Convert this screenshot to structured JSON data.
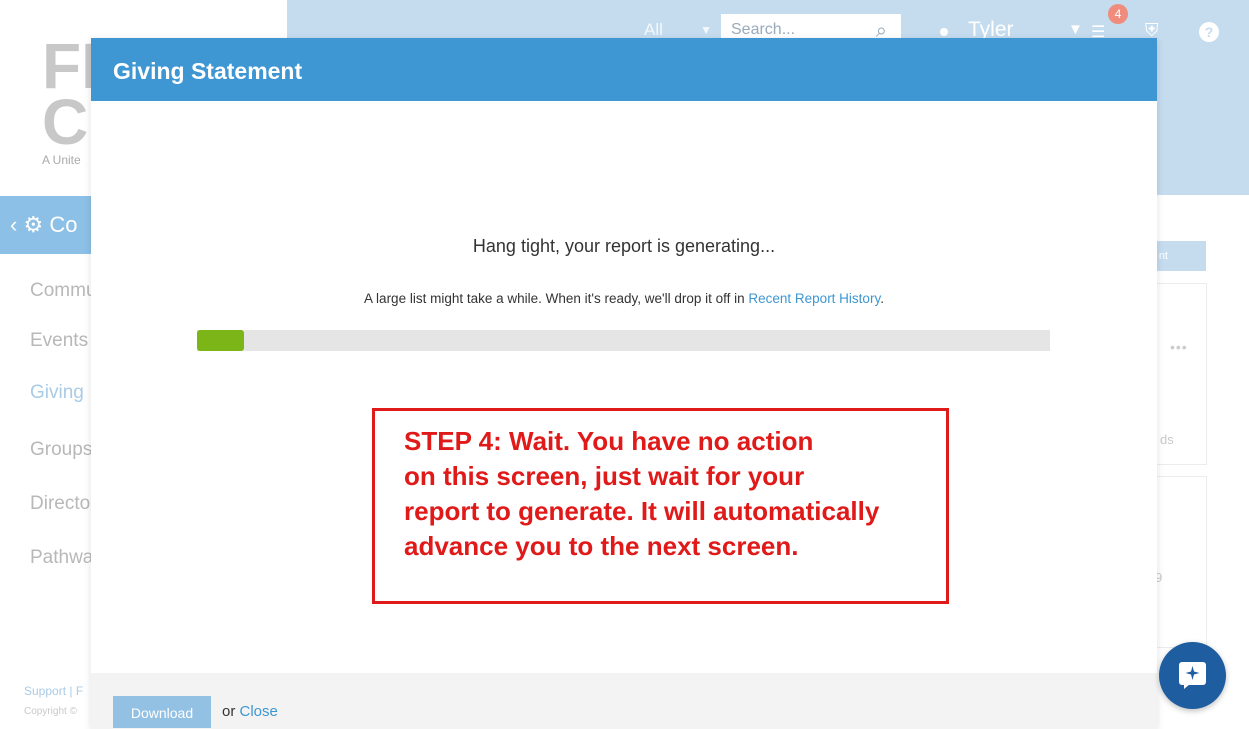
{
  "header": {
    "scope_select": "All",
    "search_placeholder": "Search...",
    "user_name": "Tyler",
    "notification_count": "4"
  },
  "sidebar": {
    "logo_text": "FI\nCI",
    "logo_sub": "A Unite",
    "section_label": "Co",
    "items": [
      {
        "label": "Commu"
      },
      {
        "label": "Events"
      },
      {
        "label": "Giving"
      },
      {
        "label": "Groups"
      },
      {
        "label": "Directo"
      },
      {
        "label": "Pathwa"
      }
    ],
    "footer_links": "Support | F",
    "copyright": "Copyright ©"
  },
  "background": {
    "button_label": "nt",
    "text_ds": "ds",
    "text_nine": "9"
  },
  "modal": {
    "title": "Giving Statement",
    "generating_title": "Hang tight, your report is generating...",
    "generating_sub": "A large list might take a while. When it's ready, we'll drop it off in",
    "history_link": "Recent Report History",
    "progress_fraction": 0.055,
    "annotation_lines": [
      "STEP 4: Wait. You have no action",
      "on this screen, just wait for your",
      "report to generate. It will automatically",
      "advance you to the next screen."
    ],
    "download_label": "Download",
    "or_text": "or",
    "close_label": "Close"
  },
  "colors": {
    "brand_blue": "#3e97d2",
    "progress_green": "#7cb518",
    "annotation_red": "#e01919"
  }
}
